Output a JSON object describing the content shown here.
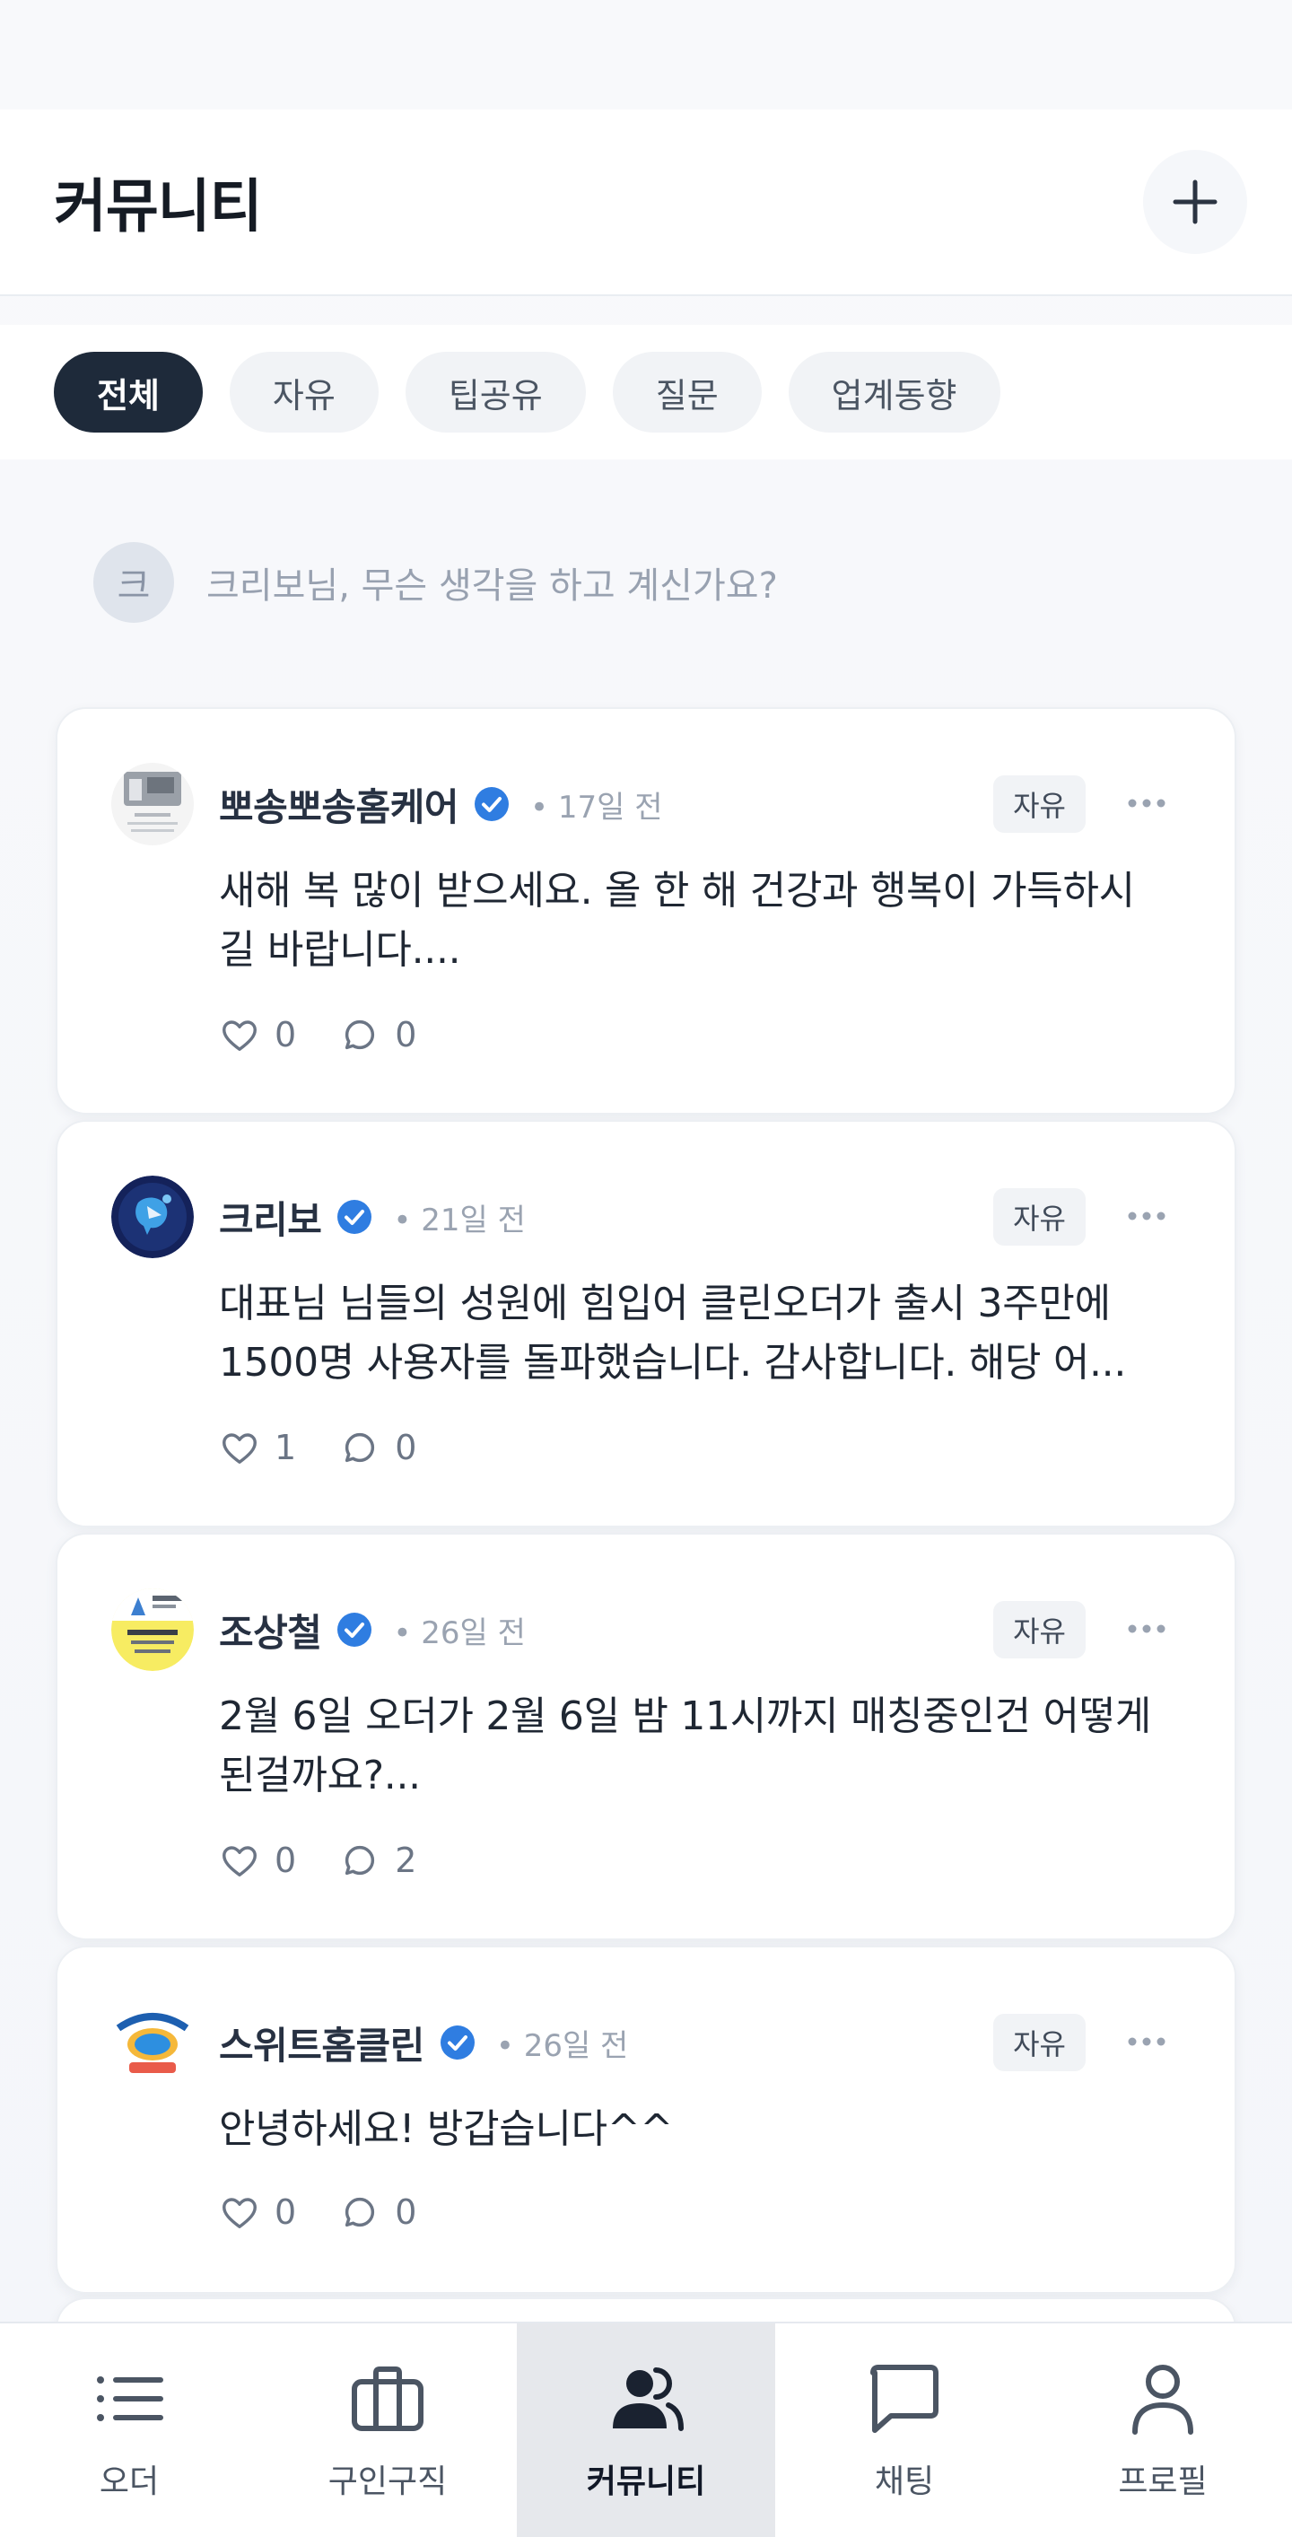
{
  "header": {
    "title": "커뮤니티"
  },
  "tabs": [
    {
      "label": "전체",
      "active": true
    },
    {
      "label": "자유",
      "active": false
    },
    {
      "label": "팁공유",
      "active": false
    },
    {
      "label": "질문",
      "active": false
    },
    {
      "label": "업계동향",
      "active": false
    }
  ],
  "composer": {
    "avatar_initial": "크",
    "placeholder": "크리보님, 무슨 생각을 하고 계신가요?"
  },
  "posts": [
    {
      "author": "뽀송뽀송홈케어",
      "verified": true,
      "time": "• 17일 전",
      "category": "자유",
      "body_line1": "새해 복 많이 받으세요. 올 한 해 건강과 행복이 가득하시",
      "body_line2": "길 바랍니다....",
      "likes": "0",
      "comments": "0"
    },
    {
      "author": "크리보",
      "verified": true,
      "time": "• 21일 전",
      "category": "자유",
      "body_line1": "대표님 님들의 성원에 힘입어 클린오더가 출시 3주만에",
      "body_line2": "1500명 사용자를 돌파했습니다. 감사합니다. 해당 어...",
      "likes": "1",
      "comments": "0"
    },
    {
      "author": "조상철",
      "verified": true,
      "time": "• 26일 전",
      "category": "자유",
      "body_line1": "2월 6일 오더가 2월 6일 밤 11시까지 매칭중인건 어떻게",
      "body_line2": "된걸까요?...",
      "likes": "0",
      "comments": "2"
    },
    {
      "author": "스위트홈클린",
      "verified": true,
      "time": "• 26일 전",
      "category": "자유",
      "body_line1": "안녕하세요! 방갑습니다^^",
      "body_line2": "",
      "likes": "0",
      "comments": "0"
    }
  ],
  "bottom_nav": [
    {
      "label": "오더",
      "icon": "list-icon",
      "active": false
    },
    {
      "label": "구인구직",
      "icon": "briefcase-icon",
      "active": false
    },
    {
      "label": "커뮤니티",
      "icon": "users-icon",
      "active": true
    },
    {
      "label": "채팅",
      "icon": "chat-icon",
      "active": false
    },
    {
      "label": "프로필",
      "icon": "user-icon",
      "active": false
    }
  ],
  "colors": {
    "accent": "#2f7de1",
    "active_tab": "#1e2a3a"
  }
}
